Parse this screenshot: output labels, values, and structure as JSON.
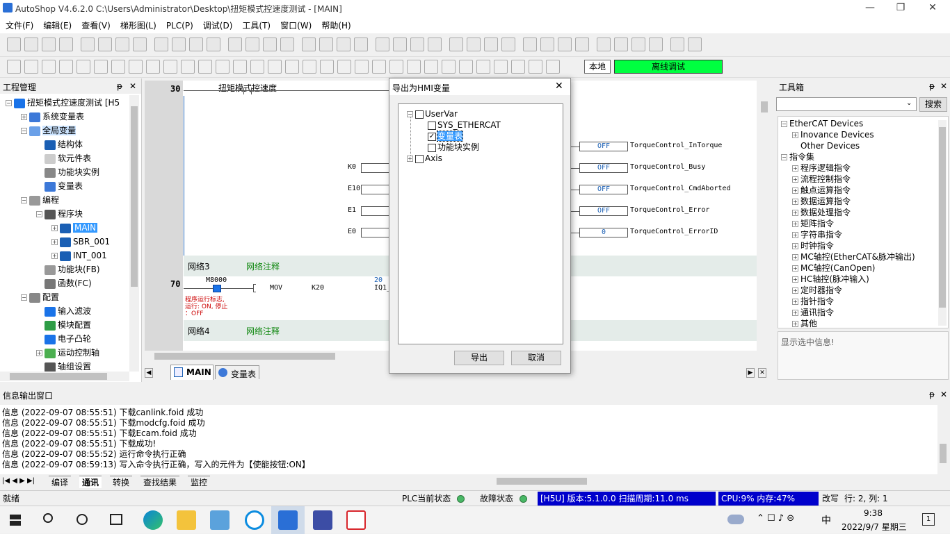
{
  "window": {
    "title": "AutoShop V4.6.2.0  C:\\Users\\Administrator\\Desktop\\扭矩模式控速度测试 - [MAIN]",
    "minimize": "—",
    "restore": "❐",
    "close": "✕"
  },
  "menu": [
    "文件(F)",
    "编辑(E)",
    "查看(V)",
    "梯形图(L)",
    "PLC(P)",
    "调试(D)",
    "工具(T)",
    "窗口(W)",
    "帮助(H)"
  ],
  "toolbar2": {
    "local_button": "本地",
    "mode_label": "离线调试"
  },
  "project_panel": {
    "title": "工程管理",
    "pin": "ᵽ",
    "close": "✕",
    "items": [
      {
        "label": "扭矩模式控速度测试 [H5"
      },
      {
        "label": "系统变量表"
      },
      {
        "label": "全局变量"
      },
      {
        "label": "结构体"
      },
      {
        "label": "软元件表"
      },
      {
        "label": "功能块实例"
      },
      {
        "label": "变量表"
      },
      {
        "label": "编程"
      },
      {
        "label": "程序块"
      },
      {
        "label": "MAIN"
      },
      {
        "label": "SBR_001"
      },
      {
        "label": "INT_001"
      },
      {
        "label": "功能块(FB)"
      },
      {
        "label": "函数(FC)"
      },
      {
        "label": "配置"
      },
      {
        "label": "输入滤波"
      },
      {
        "label": "模块配置"
      },
      {
        "label": "电子凸轮"
      },
      {
        "label": "运动控制轴"
      },
      {
        "label": "轴组设置"
      }
    ]
  },
  "editor": {
    "rung_30": "30",
    "rung_30_comment": "扭矩模式控速度",
    "inputs": [
      {
        "label": "K0"
      },
      {
        "label": "E10"
      },
      {
        "label": "E1"
      },
      {
        "label": "E0"
      }
    ],
    "outputs": [
      {
        "value": "OFF",
        "name": "TorqueControl_InTorque"
      },
      {
        "value": "OFF",
        "name": "TorqueControl_Busy"
      },
      {
        "value": "OFF",
        "name": "TorqueControl_CmdAborted"
      },
      {
        "value": "OFF",
        "name": "TorqueControl_Error"
      },
      {
        "value": "0",
        "name": "TorqueControl_ErrorID"
      }
    ],
    "network3": "网络3",
    "network3_comment": "网络注释",
    "rung_70": "70",
    "contact_m8000": "M8000",
    "instr_mov": "MOV",
    "operand_k20": "K20",
    "operand_val": "20",
    "operand_iq1": "IQ1_",
    "comment_lines": [
      "程序运行标志,",
      "运行: ON, 停止",
      "：OFF"
    ],
    "network4": "网络4",
    "network4_comment": "网络注释",
    "tabs": [
      {
        "label": "MAIN"
      },
      {
        "label": "变量表"
      }
    ]
  },
  "dialog": {
    "title": "导出为HMI变量",
    "close": "✕",
    "tree": [
      {
        "label": "UserVar",
        "checked": false
      },
      {
        "label": "SYS_ETHERCAT",
        "checked": false
      },
      {
        "label": "变量表",
        "checked": true
      },
      {
        "label": "功能块实例",
        "checked": false
      },
      {
        "label": "Axis",
        "checked": false
      }
    ],
    "export_button": "导出",
    "cancel_button": "取消"
  },
  "toolbox": {
    "title": "工具箱",
    "search_button": "搜索",
    "items": [
      {
        "label": "EtherCAT Devices"
      },
      {
        "label": "Inovance Devices"
      },
      {
        "label": "Other Devices"
      },
      {
        "label": "指令集"
      },
      {
        "label": "程序逻辑指令"
      },
      {
        "label": "流程控制指令"
      },
      {
        "label": "触点运算指令"
      },
      {
        "label": "数据运算指令"
      },
      {
        "label": "数据处理指令"
      },
      {
        "label": "矩阵指令"
      },
      {
        "label": "字符串指令"
      },
      {
        "label": "时钟指令"
      },
      {
        "label": "MC轴控(EtherCAT&脉冲输出)"
      },
      {
        "label": "MC轴控(CanOpen)"
      },
      {
        "label": "HC轴控(脉冲输入)"
      },
      {
        "label": "定时器指令"
      },
      {
        "label": "指针指令"
      },
      {
        "label": "通讯指令"
      },
      {
        "label": "其他"
      }
    ],
    "info": "显示选中信息!"
  },
  "output_panel": {
    "title": "信息输出窗口",
    "lines": [
      "信息  (2022-09-07 08:55:51)  下载canlink.foid 成功",
      "信息  (2022-09-07 08:55:51)  下载modcfg.foid 成功",
      "信息  (2022-09-07 08:55:51)  下载Ecam.foid 成功",
      "信息  (2022-09-07 08:55:51)  下载成功!",
      "信息  (2022-09-07 08:55:52)  运行命令执行正确",
      "信息  (2022-09-07 08:59:13)  写入命令执行正确，写入的元件为【使能按钮:ON】"
    ],
    "tabs": [
      "编译",
      "通讯",
      "转换",
      "查找结果",
      "监控"
    ]
  },
  "statusbar": {
    "ready": "就绪",
    "plc_state": "PLC当前状态",
    "fault_state": "故障状态",
    "version": "[H5U] 版本:5.1.0.0 扫描周期:11.0 ms",
    "cpu": "CPU:9%  内存:47%",
    "overwrite": "改写",
    "rowcol": "行:   2, 列:    1"
  },
  "taskbar": {
    "time": "9:38",
    "date": "2022/9/7 星期三",
    "ime": "中",
    "notif": "1"
  },
  "colors": {
    "accent": "#3399ff",
    "mode_green": "#00ff40",
    "status_blue": "#0000cc"
  }
}
